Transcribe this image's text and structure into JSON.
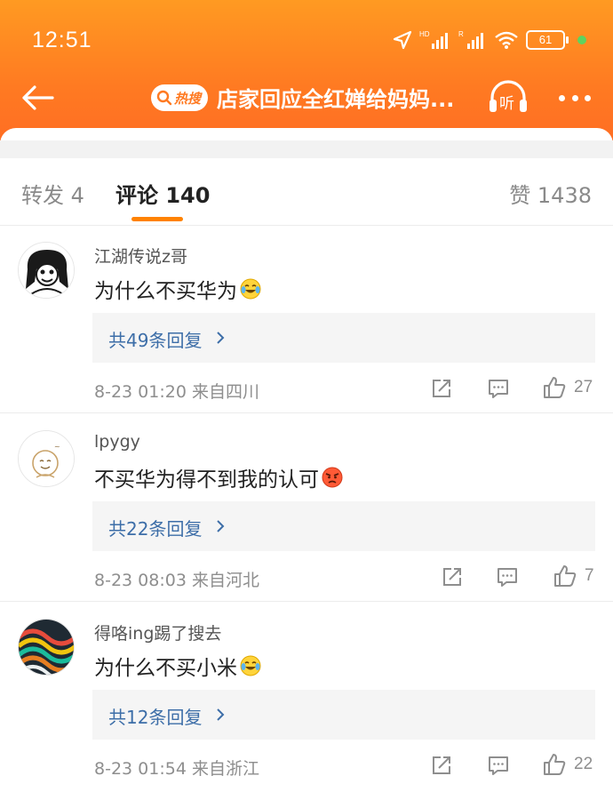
{
  "status": {
    "time": "12:51",
    "battery": "61"
  },
  "nav": {
    "hot_badge": "热搜",
    "title": "店家回应全红婵给妈妈..."
  },
  "tabs": {
    "repost": "转发 4",
    "comments": "评论 140",
    "likes": "赞 1438"
  },
  "comments": [
    {
      "username": "江湖传说z哥",
      "text": "为什么不买华为",
      "emoji": "laugh-cry-emoji",
      "replies": "共49条回复",
      "meta": "8-23 01:20  来自四川",
      "likes": "27"
    },
    {
      "username": "lpygy",
      "text": "不买华为得不到我的认可",
      "emoji": "angry-emoji",
      "replies": "共22条回复",
      "meta": "8-23 08:03  来自河北",
      "likes": "7"
    },
    {
      "username": "得咯ing踢了搜去",
      "text": "为什么不买小米",
      "emoji": "laugh-cry-emoji",
      "replies": "共12条回复",
      "meta": "8-23 01:54  来自浙江",
      "likes": "22"
    }
  ],
  "colors": {
    "header": "#ff7a22",
    "accent": "#ff8200",
    "link": "#3d6ea8"
  }
}
